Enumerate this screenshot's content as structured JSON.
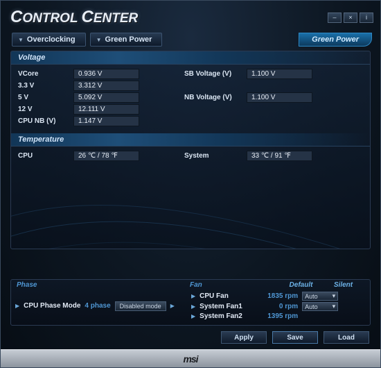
{
  "app": {
    "title": "CONTROL CENTER",
    "footer_brand": "msi"
  },
  "tabs": {
    "overclocking": "Overclocking",
    "green_power": "Green Power",
    "active_pill": "Green Power"
  },
  "voltage": {
    "header": "Voltage",
    "rows_left": [
      {
        "label": "VCore",
        "value": "0.936 V"
      },
      {
        "label": "3.3 V",
        "value": "3.312 V"
      },
      {
        "label": "5 V",
        "value": "5.092 V"
      },
      {
        "label": "12 V",
        "value": "12.111 V"
      },
      {
        "label": "CPU NB (V)",
        "value": "1.147 V"
      }
    ],
    "rows_right": [
      {
        "label": "SB Voltage (V)",
        "value": "1.100 V"
      },
      {
        "label": "NB Voltage (V)",
        "value": "1.100 V"
      }
    ]
  },
  "temperature": {
    "header": "Temperature",
    "cpu_label": "CPU",
    "cpu_value": "26 ℃ / 78 ℉",
    "sys_label": "System",
    "sys_value": "33 ℃ / 91 ℉"
  },
  "phase": {
    "header": "Phase",
    "row_label": "CPU Phase Mode",
    "phases": "4 phase",
    "mode_button": "Disabled mode"
  },
  "fan": {
    "header": "Fan",
    "col_default": "Default",
    "col_silent": "Silent",
    "rows": [
      {
        "name": "CPU Fan",
        "rpm": "1835 rpm",
        "mode": "Auto"
      },
      {
        "name": "System Fan1",
        "rpm": "0 rpm",
        "mode": "Auto"
      },
      {
        "name": "System Fan2",
        "rpm": "1395 rpm",
        "mode": ""
      }
    ]
  },
  "actions": {
    "apply": "Apply",
    "save": "Save",
    "load": "Load"
  }
}
